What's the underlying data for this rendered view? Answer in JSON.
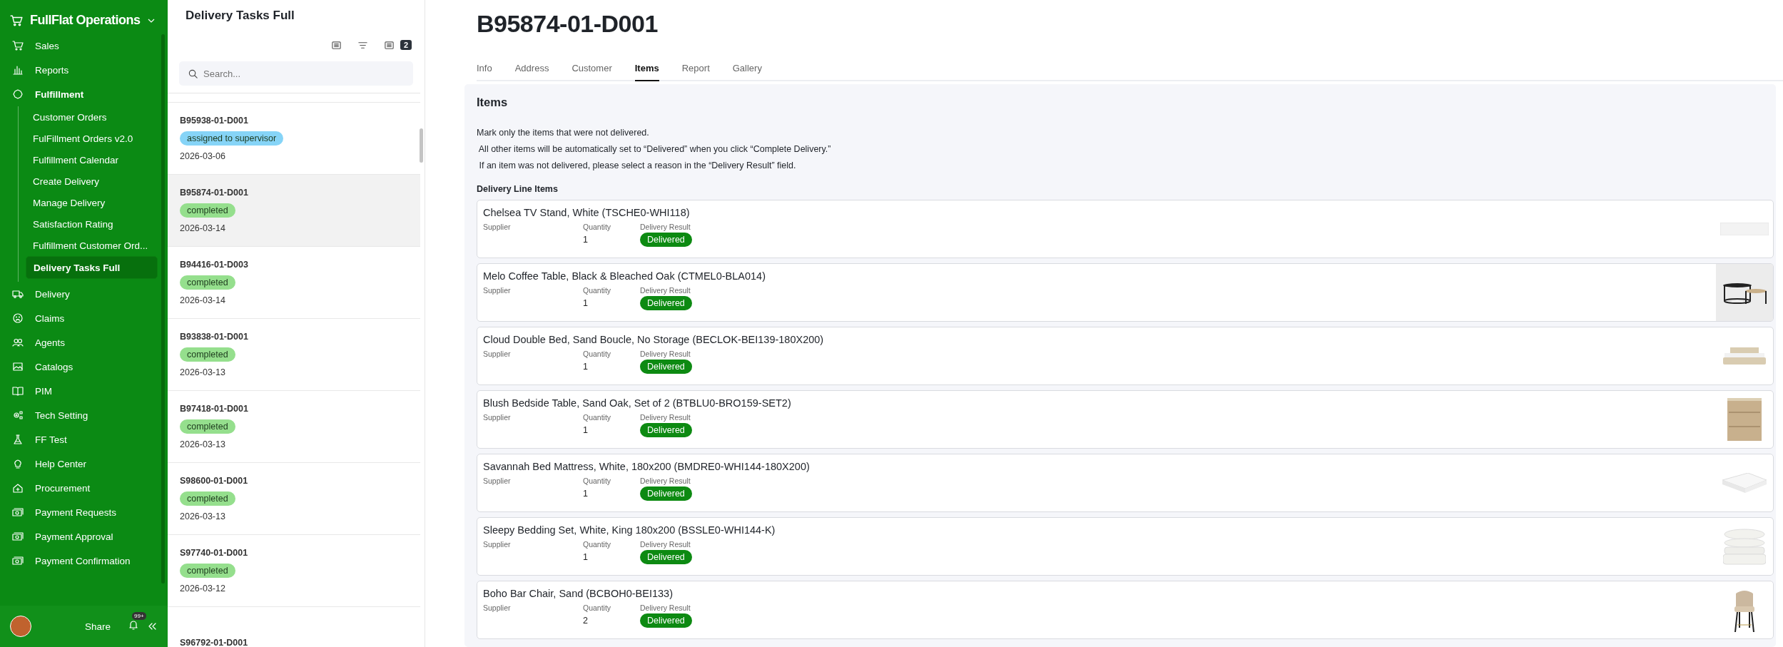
{
  "app": {
    "title": "FullFlat Operations"
  },
  "sidebar": {
    "items": [
      {
        "label": "Sales",
        "expanded": false
      },
      {
        "label": "Reports",
        "expanded": false
      },
      {
        "label": "Fulfillment",
        "expanded": true,
        "children": [
          {
            "label": "Customer Orders",
            "selected": false
          },
          {
            "label": "FulFillment Orders v2.0",
            "selected": false
          },
          {
            "label": "Fulfillment Calendar",
            "selected": false
          },
          {
            "label": "Create Delivery",
            "selected": false
          },
          {
            "label": "Manage Delivery",
            "selected": false
          },
          {
            "label": "Satisfaction Rating",
            "selected": false
          },
          {
            "label": "Fulfillment Customer Ord...",
            "selected": false
          },
          {
            "label": "Delivery Tasks Full",
            "selected": true
          }
        ]
      },
      {
        "label": "Delivery",
        "expanded": false
      },
      {
        "label": "Claims",
        "expanded": false
      },
      {
        "label": "Agents",
        "expanded": false
      },
      {
        "label": "Catalogs",
        "expanded": false
      },
      {
        "label": "PIM",
        "expanded": false
      },
      {
        "label": "Tech Setting",
        "expanded": false
      },
      {
        "label": "FF Test",
        "expanded": false
      },
      {
        "label": "Help Center",
        "expanded": false
      },
      {
        "label": "Procurement",
        "expanded": false
      },
      {
        "label": "Payment Requests",
        "expanded": false
      },
      {
        "label": "Payment Approval",
        "expanded": false
      },
      {
        "label": "Payment Confirmation",
        "expanded": false
      }
    ],
    "footer": {
      "share": "Share",
      "notifications": "99+"
    }
  },
  "task_list": {
    "title": "Delivery Tasks Full",
    "filter_count": "2",
    "search": {
      "placeholder": "Search..."
    },
    "tasks": [
      {
        "id": "B95938-01-D001",
        "status": "assigned to supervisor",
        "color": "#86d4f7",
        "date": "2026-03-06",
        "selected": false
      },
      {
        "id": "B95874-01-D001",
        "status": "completed",
        "color": "#95df8d",
        "date": "2026-03-14",
        "selected": true
      },
      {
        "id": "B94416-01-D003",
        "status": "completed",
        "color": "#95df8d",
        "date": "2026-03-14",
        "selected": false
      },
      {
        "id": "B93838-01-D001",
        "status": "completed",
        "color": "#95df8d",
        "date": "2026-03-13",
        "selected": false
      },
      {
        "id": "B97418-01-D001",
        "status": "completed",
        "color": "#95df8d",
        "date": "2026-03-13",
        "selected": false
      },
      {
        "id": "S98600-01-D001",
        "status": "completed",
        "color": "#95df8d",
        "date": "2026-03-13",
        "selected": false
      },
      {
        "id": "S97740-01-D001",
        "status": "completed",
        "color": "#95df8d",
        "date": "2026-03-12",
        "selected": false
      },
      {
        "id": "S96792-01-D001",
        "selected": false
      }
    ]
  },
  "detail": {
    "title": "B95874-01-D001",
    "tabs": [
      {
        "label": "Info",
        "selected": false
      },
      {
        "label": "Address",
        "selected": false
      },
      {
        "label": "Customer",
        "selected": false
      },
      {
        "label": "Items",
        "selected": true
      },
      {
        "label": "Report",
        "selected": false
      },
      {
        "label": "Gallery",
        "selected": false
      }
    ],
    "section_title": "Items",
    "instructions": [
      "Mark only the items that were not delivered.",
      " All other items will be automatically set to “Delivered” when you click “Complete Delivery.”",
      " If an item was not delivered, please select a reason in the “Delivery Result” field."
    ],
    "line_items_title": "Delivery Line Items",
    "line_items": [
      {
        "name": "Chelsea TV Stand, White (TSCHE0-WHI118)",
        "supplier_label": "Supplier",
        "quantity_label": "Quantity",
        "quantity": "1",
        "result_label": "Delivery Result",
        "result": "Delivered",
        "kind": "picture"
      },
      {
        "name": "Melo Coffee Table, Black & Bleached Oak (CTMEL0-BLA014)",
        "supplier_label": "Supplier",
        "quantity_label": "Quantity",
        "quantity": "1",
        "result_label": "Delivery Result",
        "result": "Delivered",
        "kind": "picture"
      },
      {
        "name": "Cloud Double Bed, Sand Boucle, No Storage (BECLOK-BEI139-180X200)",
        "supplier_label": "Supplier",
        "quantity_label": "Quantity",
        "quantity": "1",
        "result_label": "Delivery Result",
        "result": "Delivered",
        "kind": "picture"
      },
      {
        "name": "Blush Bedside Table, Sand Oak, Set of 2 (BTBLU0-BRO159-SET2)",
        "supplier_label": "Supplier",
        "quantity_label": "Quantity",
        "quantity": "1",
        "result_label": "Delivery Result",
        "result": "Delivered",
        "kind": "picture"
      },
      {
        "name": "Savannah Bed Mattress, White, 180x200 (BMDRE0-WHI144-180X200)",
        "supplier_label": "Supplier",
        "quantity_label": "Quantity",
        "quantity": "1",
        "result_label": "Delivery Result",
        "result": "Delivered",
        "kind": "picture"
      },
      {
        "name": "Sleepy Bedding Set, White, King 180x200 (BSSLE0-WHI144-K)",
        "supplier_label": "Supplier",
        "quantity_label": "Quantity",
        "quantity": "1",
        "result_label": "Delivery Result",
        "result": "Delivered",
        "kind": "picture"
      },
      {
        "name": "Boho Bar Chair, Sand (BCBOH0-BEI133)",
        "supplier_label": "Supplier",
        "quantity_label": "Quantity",
        "quantity": "2",
        "result_label": "Delivery Result",
        "result": "Delivered",
        "kind": "picture"
      }
    ]
  }
}
